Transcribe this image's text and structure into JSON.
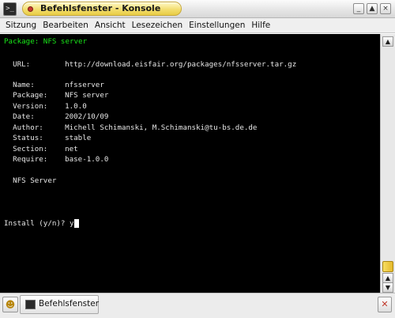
{
  "window": {
    "title": "Befehlsfenster - Konsole",
    "buttons": {
      "minimize": "_",
      "maximize": "▲",
      "close": "×"
    }
  },
  "menu": [
    "Sitzung",
    "Bearbeiten",
    "Ansicht",
    "Lesezeichen",
    "Einstellungen",
    "Hilfe"
  ],
  "terminal": {
    "header": "Package: NFS server",
    "url_label": "URL:",
    "url_value": "http://download.eisfair.org/packages/nfsserver.tar.gz",
    "fields": [
      {
        "label": "Name:",
        "value": "nfsserver"
      },
      {
        "label": "Package:",
        "value": "NFS server"
      },
      {
        "label": "Version:",
        "value": "1.0.0"
      },
      {
        "label": "Date:",
        "value": "2002/10/09"
      },
      {
        "label": "Author:",
        "value": "Michell Schimanski, M.Schimanski@tu-bs.de.de"
      },
      {
        "label": "Status:",
        "value": "stable"
      },
      {
        "label": "Section:",
        "value": "net"
      },
      {
        "label": "Require:",
        "value": "base-1.0.0"
      }
    ],
    "description": "NFS Server",
    "prompt": "Install (y/n)? ",
    "input": "y"
  },
  "tabs": [
    {
      "label": "Befehlsfenster"
    }
  ],
  "colors": {
    "terminal_bg": "#000000",
    "terminal_fg": "#e6e6e6",
    "header_green": "#19e619",
    "title_yellow": "#f2dc6a"
  }
}
